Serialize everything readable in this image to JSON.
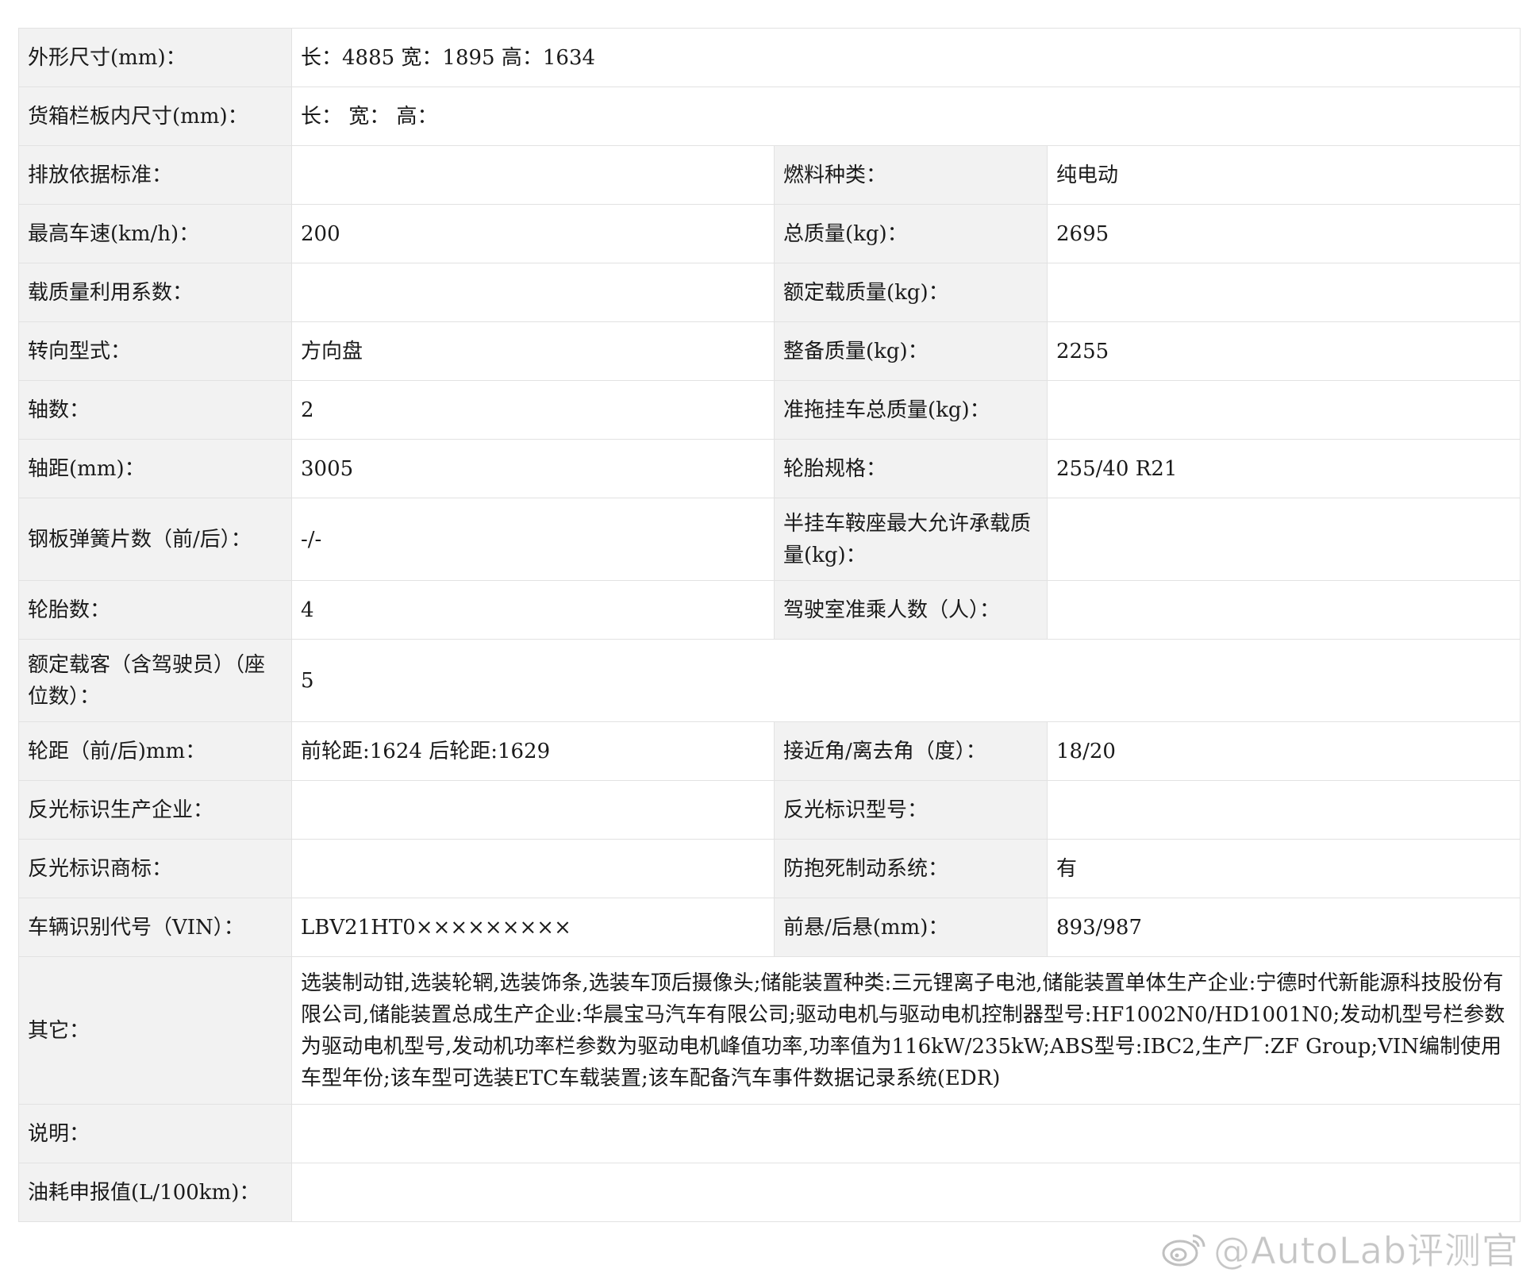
{
  "rows": [
    {
      "l1": "外形尺寸(mm)：",
      "v1": "长：4885 宽：1895 高：1634"
    },
    {
      "l1": "货箱栏板内尺寸(mm)：",
      "v1": "长：  宽：  高："
    },
    {
      "l1": "排放依据标准：",
      "v1": "",
      "l2": "燃料种类：",
      "v2": "纯电动"
    },
    {
      "l1": "最高车速(km/h)：",
      "v1": "200",
      "l2": "总质量(kg)：",
      "v2": "2695"
    },
    {
      "l1": "载质量利用系数：",
      "v1": "",
      "l2": "额定载质量(kg)：",
      "v2": ""
    },
    {
      "l1": "转向型式：",
      "v1": "方向盘",
      "l2": "整备质量(kg)：",
      "v2": "2255"
    },
    {
      "l1": "轴数：",
      "v1": "2",
      "l2": "准拖挂车总质量(kg)：",
      "v2": ""
    },
    {
      "l1": "轴距(mm)：",
      "v1": "3005",
      "l2": "轮胎规格：",
      "v2": "255/40 R21"
    },
    {
      "l1": "钢板弹簧片数（前/后）：",
      "v1": "-/-",
      "l2": "半挂车鞍座最大允许承载质量(kg)：",
      "v2": ""
    },
    {
      "l1": "轮胎数：",
      "v1": "4",
      "l2": "驾驶室准乘人数（人）：",
      "v2": ""
    },
    {
      "l1": "额定载客（含驾驶员）（座位数）：",
      "v1": "5"
    },
    {
      "l1": "轮距（前/后)mm：",
      "v1": "前轮距:1624 后轮距:1629",
      "l2": "接近角/离去角（度）：",
      "v2": "18/20"
    },
    {
      "l1": "反光标识生产企业：",
      "v1": "",
      "l2": "反光标识型号：",
      "v2": ""
    },
    {
      "l1": "反光标识商标：",
      "v1": "",
      "l2": "防抱死制动系统：",
      "v2": "有"
    },
    {
      "l1": "车辆识别代号（VIN）：",
      "v1": "LBV21HT0×××××××××",
      "l2": "前悬/后悬(mm)：",
      "v2": "893/987"
    },
    {
      "l1": "其它：",
      "v1": "选装制动钳,选装轮辋,选装饰条,选装车顶后摄像头;储能装置种类:三元锂离子电池,储能装置单体生产企业:宁德时代新能源科技股份有限公司,储能装置总成生产企业:华晨宝马汽车有限公司;驱动电机与驱动电机控制器型号:HF1002N0/HD1001N0;发动机型号栏参数为驱动电机型号,发动机功率栏参数为驱动电机峰值功率,功率值为116kW/235kW;ABS型号:IBC2,生产厂:ZF Group;VIN编制使用车型年份;该车型可选装ETC车载装置;该车配备汽车事件数据记录系统(EDR)"
    },
    {
      "l1": "说明：",
      "v1": ""
    },
    {
      "l1": "油耗申报值(L/100km)：",
      "v1": ""
    }
  ],
  "watermark": {
    "text": "@AutoLab评测官",
    "icon": "weibo-icon"
  }
}
